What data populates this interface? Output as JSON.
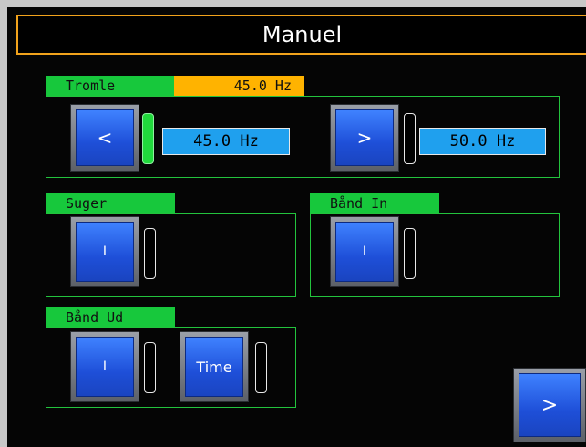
{
  "header": {
    "title": "Manuel"
  },
  "tromle": {
    "label": "Tromle",
    "readout": "45.0 Hz",
    "down_button": "<",
    "up_button": ">",
    "min_value": "45.0 Hz",
    "max_value": "50.0 Hz"
  },
  "suger": {
    "label": "Suger",
    "button": "I"
  },
  "band_in": {
    "label": "Bånd In",
    "button": "I"
  },
  "band_ud": {
    "label": "Bånd Ud",
    "button": "I",
    "time_button": "Time"
  },
  "nav": {
    "next_button": ">"
  },
  "colors": {
    "group_green": "#17c83c",
    "readout_orange": "#ffb300",
    "title_border": "#f2a31c",
    "button_blue": "#1e4fd8",
    "value_blue": "#1fa0ee"
  }
}
